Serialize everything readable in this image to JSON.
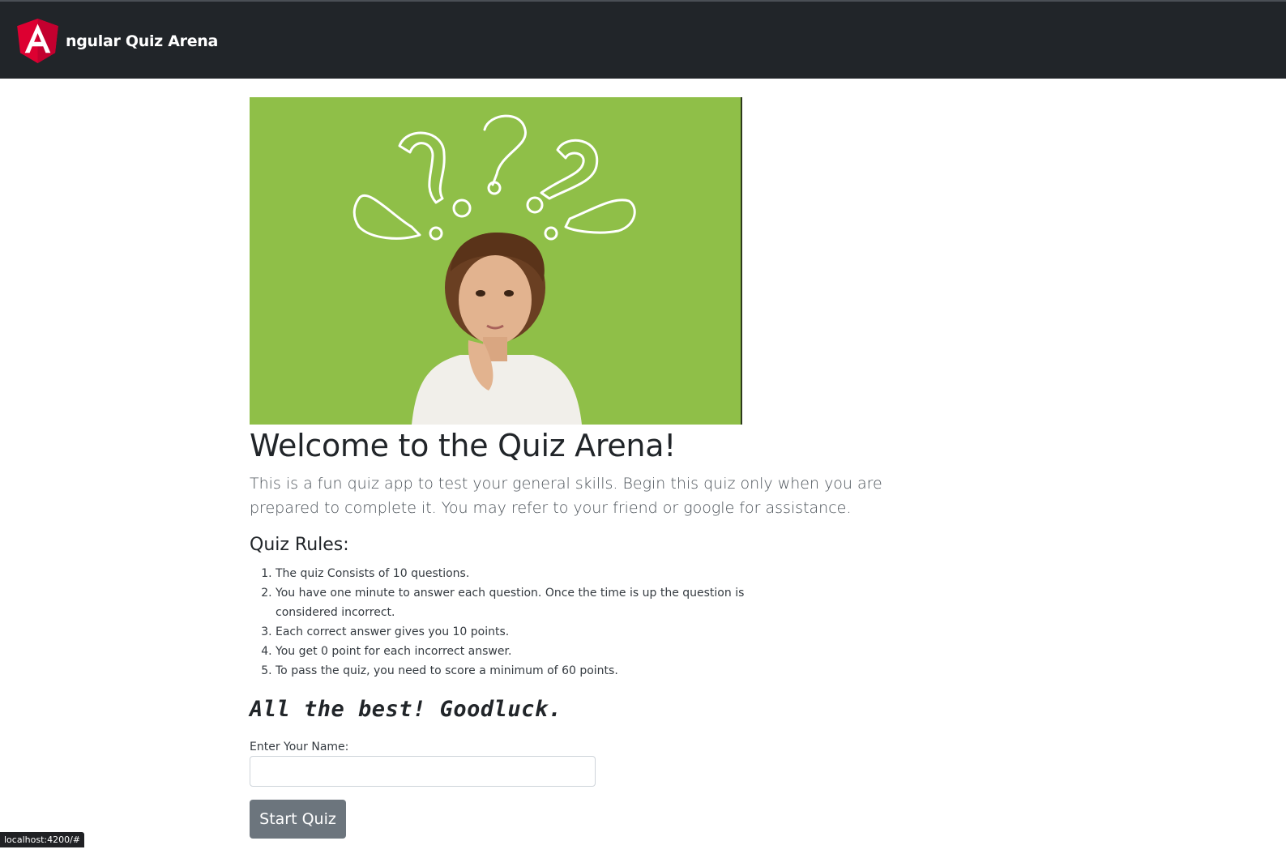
{
  "navbar": {
    "brand_text": "ngular Quiz Arena",
    "logo_icon": "angular-logo-icon",
    "background": "#212529",
    "logo_color": "#dd0031"
  },
  "hero": {
    "image": "thinking-child-question-marks-image",
    "background": "#8fbf48"
  },
  "welcome": {
    "title": "Welcome to the Quiz Arena!",
    "lead": "This is a fun quiz app to test your general skills. Begin this quiz only when you are prepared to complete it. You may refer to your friend or google for assistance."
  },
  "rules": {
    "title": "Quiz Rules:",
    "items": [
      "The quiz Consists of 10 questions.",
      "You have one minute to answer each question. Once the time is up the question is considered incorrect.",
      "Each correct answer gives you 10 points.",
      "You get 0 point for each incorrect answer.",
      "To pass the quiz, you need to score a minimum of 60 points."
    ]
  },
  "goodluck": "All the best! Goodluck.",
  "form": {
    "name_label": "Enter Your Name:",
    "name_value": "",
    "start_label": "Start Quiz",
    "button_color": "#6c757d"
  },
  "status_bar": {
    "url": "localhost:4200/#"
  }
}
